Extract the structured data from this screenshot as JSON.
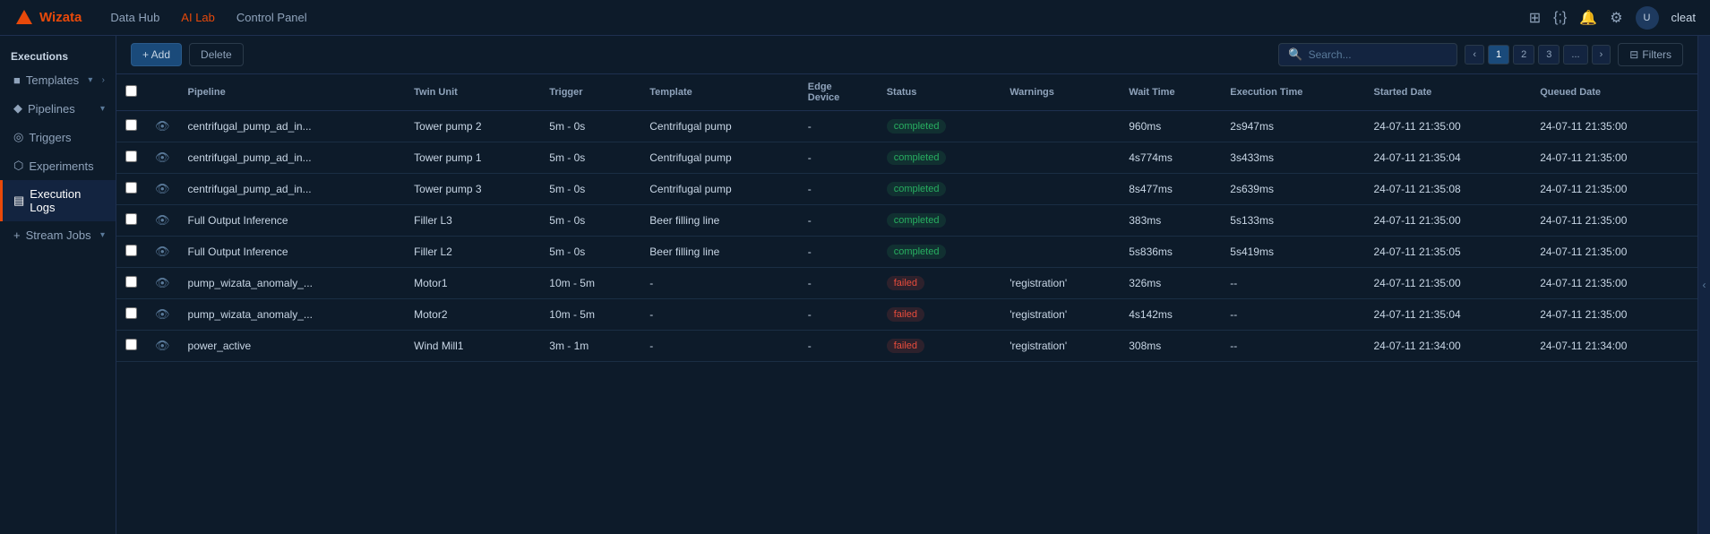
{
  "app": {
    "logo_text": "Wizata",
    "logo_color": "#e8490a"
  },
  "nav": {
    "links": [
      {
        "label": "Data Hub",
        "active": false
      },
      {
        "label": "AI Lab",
        "active": true
      },
      {
        "label": "Control Panel",
        "active": false
      }
    ],
    "user_label": "cleat",
    "icons": [
      "grid-icon",
      "code-icon",
      "bell-icon",
      "gear-icon",
      "user-icon"
    ]
  },
  "sidebar": {
    "header": "Executions",
    "items": [
      {
        "label": "Templates",
        "icon": "■",
        "active": false,
        "has_arrow": true
      },
      {
        "label": "Pipelines",
        "icon": "◆",
        "active": false,
        "has_arrow": true
      },
      {
        "label": "Triggers",
        "icon": "◎",
        "active": false,
        "has_arrow": false
      },
      {
        "label": "Experiments",
        "icon": "⬡",
        "active": false,
        "has_arrow": false
      },
      {
        "label": "Execution Logs",
        "icon": "▤",
        "active": true,
        "has_arrow": false
      },
      {
        "label": "Stream Jobs",
        "icon": "+",
        "active": false,
        "has_arrow": true
      }
    ]
  },
  "toolbar": {
    "add_label": "+ Add",
    "delete_label": "Delete",
    "search_placeholder": "Search...",
    "filters_label": "Filters",
    "pagination": [
      "1",
      "2",
      "3",
      "..."
    ]
  },
  "table": {
    "columns": [
      {
        "label": ""
      },
      {
        "label": ""
      },
      {
        "label": "Pipeline"
      },
      {
        "label": "Twin Unit"
      },
      {
        "label": "Trigger"
      },
      {
        "label": "Template"
      },
      {
        "label": "Edge Device"
      },
      {
        "label": "Status"
      },
      {
        "label": "Warnings"
      },
      {
        "label": "Wait Time"
      },
      {
        "label": "Execution Time"
      },
      {
        "label": "Started Date"
      },
      {
        "label": "Queued Date"
      }
    ],
    "rows": [
      {
        "pipeline": "centrifugal_pump_ad_in...",
        "twin_unit": "Tower pump 2",
        "trigger": "5m - 0s",
        "template": "Centrifugal pump",
        "edge_device": "-",
        "status": "completed",
        "warnings": "",
        "wait_time": "960ms",
        "execution_time": "2s947ms",
        "started_date": "24-07-11 21:35:00",
        "queued_date": "24-07-11 21:35:00"
      },
      {
        "pipeline": "centrifugal_pump_ad_in...",
        "twin_unit": "Tower pump 1",
        "trigger": "5m - 0s",
        "template": "Centrifugal pump",
        "edge_device": "-",
        "status": "completed",
        "warnings": "",
        "wait_time": "4s774ms",
        "execution_time": "3s433ms",
        "started_date": "24-07-11 21:35:04",
        "queued_date": "24-07-11 21:35:00"
      },
      {
        "pipeline": "centrifugal_pump_ad_in...",
        "twin_unit": "Tower pump 3",
        "trigger": "5m - 0s",
        "template": "Centrifugal pump",
        "edge_device": "-",
        "status": "completed",
        "warnings": "",
        "wait_time": "8s477ms",
        "execution_time": "2s639ms",
        "started_date": "24-07-11 21:35:08",
        "queued_date": "24-07-11 21:35:00"
      },
      {
        "pipeline": "Full Output Inference",
        "twin_unit": "Filler L3",
        "trigger": "5m - 0s",
        "template": "Beer filling line",
        "edge_device": "-",
        "status": "completed",
        "warnings": "",
        "wait_time": "383ms",
        "execution_time": "5s133ms",
        "started_date": "24-07-11 21:35:00",
        "queued_date": "24-07-11 21:35:00"
      },
      {
        "pipeline": "Full Output Inference",
        "twin_unit": "Filler L2",
        "trigger": "5m - 0s",
        "template": "Beer filling line",
        "edge_device": "-",
        "status": "completed",
        "warnings": "",
        "wait_time": "5s836ms",
        "execution_time": "5s419ms",
        "started_date": "24-07-11 21:35:05",
        "queued_date": "24-07-11 21:35:00"
      },
      {
        "pipeline": "pump_wizata_anomaly_...",
        "twin_unit": "Motor1",
        "trigger": "10m - 5m",
        "template": "-",
        "edge_device": "-",
        "status": "failed",
        "warnings": "'registration'",
        "wait_time": "326ms",
        "execution_time": "--",
        "started_date": "24-07-11 21:35:00",
        "queued_date": "24-07-11 21:35:00"
      },
      {
        "pipeline": "pump_wizata_anomaly_...",
        "twin_unit": "Motor2",
        "trigger": "10m - 5m",
        "template": "-",
        "edge_device": "-",
        "status": "failed",
        "warnings": "'registration'",
        "wait_time": "4s142ms",
        "execution_time": "--",
        "started_date": "24-07-11 21:35:04",
        "queued_date": "24-07-11 21:35:00"
      },
      {
        "pipeline": "power_active",
        "twin_unit": "Wind Mill1",
        "trigger": "3m - 1m",
        "template": "-",
        "edge_device": "-",
        "status": "failed",
        "warnings": "'registration'",
        "wait_time": "308ms",
        "execution_time": "--",
        "started_date": "24-07-11 21:34:00",
        "queued_date": "24-07-11 21:34:00"
      }
    ]
  }
}
